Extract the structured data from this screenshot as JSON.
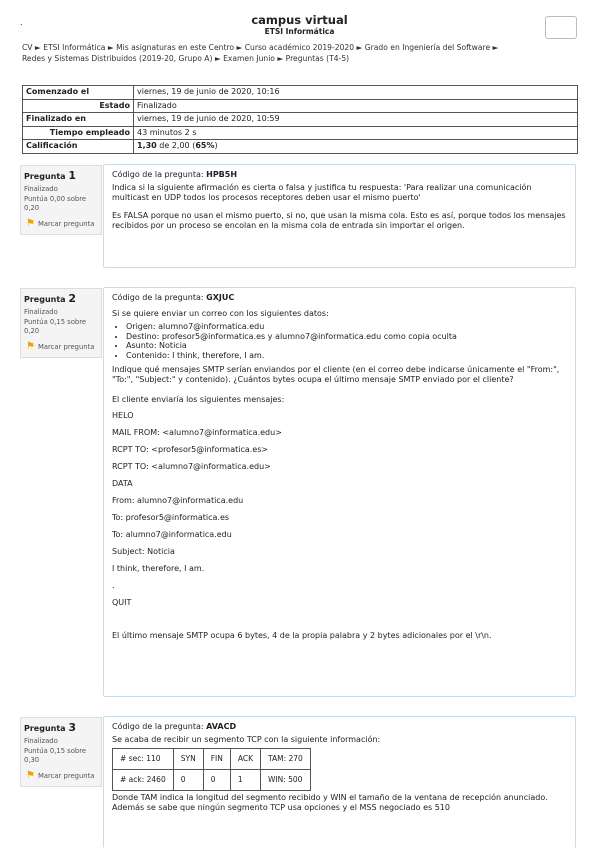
{
  "header": {
    "title": "campus virtual",
    "subtitle": "ETSI Informática",
    "dot": "."
  },
  "breadcrumb": [
    "CV ►",
    "ETSI Informática ►",
    "Mis asignaturas en este Centro ►",
    "Curso académico 2019-2020 ►",
    "Grado en Ingeniería del Software ►",
    "Redes y Sistemas Distribuidos (2019-20, Grupo A) ►",
    "Examen Junio ►",
    "Preguntas (T4-5)"
  ],
  "summary": {
    "started_label": "Comenzado el",
    "started_value": "viernes, 19 de junio de 2020, 10:16",
    "state_label": "Estado",
    "state_value": "Finalizado",
    "finished_label": "Finalizado en",
    "finished_value": "viernes, 19 de junio de 2020, 10:59",
    "time_label": "Tiempo empleado",
    "time_value": "43 minutos 2 s",
    "grade_label": "Calificación",
    "grade_score": "1,30",
    "grade_of": " de 2,00 (",
    "grade_percent": "65%",
    "grade_close": ")"
  },
  "questions": [
    {
      "label": "Pregunta",
      "number": "1",
      "state": "Finalizado",
      "score": "Puntúa 0,00 sobre 0,20",
      "flag": "Marcar pregunta",
      "code_prefix": "Código de la pregunta: ",
      "code": "HPB5H",
      "text": "Indica si la siguiente afirmación es cierta o falsa y justifica tu respuesta: 'Para realizar una comunicación multicast en UDP todos los procesos receptores deben usar el mismo puerto'",
      "answer": "Es FALSA porque no usan el mismo puerto, si no, que usan la misma cola. Esto es así, porque todos los mensajes recibidos por un proceso se encolan en la misma cola de entrada sin importar el origen."
    },
    {
      "label": "Pregunta",
      "number": "2",
      "state": "Finalizado",
      "score": "Puntúa 0,15 sobre 0,20",
      "flag": "Marcar pregunta",
      "code_prefix": "Código de la pregunta: ",
      "code": "GXJUC",
      "intro": "Si se quiere enviar un correo con los siguientes datos:",
      "bullets": [
        "Origen: alumno7@informatica.edu",
        "Destino: profesor5@informatica.es y alumno7@informatica.edu como copia oculta",
        "Asunto: Noticia",
        "Contenido: I think, therefore, I am."
      ],
      "question": "Indique qué mensajes SMTP serían enviandos por el cliente (en el correo debe indicarse únicamente el \"From:\", \"To:\", \"Subject:\" y contenido). ¿Cuántos bytes ocupa el último mensaje SMTP enviado por el cliente?",
      "answer_intro": "El cliente enviaría los siguientes mensajes:",
      "answer_lines": [
        "HELO",
        "MAIL FROM: <alumno7@informatica.edu>",
        "RCPT TO: <profesor5@informatica.es>",
        "RCPT TO: <alumno7@informatica.edu>",
        "DATA",
        "From: alumno7@informatica.edu",
        "To: profesor5@informatica.es",
        "To: alumno7@informatica.edu",
        "Subject: Noticia",
        "I think, therefore, I am.",
        ".",
        "QUIT"
      ],
      "answer_end": "El último mensaje SMTP ocupa 6 bytes, 4 de la propia palabra y 2 bytes adicionales por el \\r\\n."
    },
    {
      "label": "Pregunta",
      "number": "3",
      "state": "Finalizado",
      "score": "Puntúa 0,15 sobre 0,30",
      "flag": "Marcar pregunta",
      "code_prefix": "Código de la pregunta: ",
      "code": "AVACD",
      "intro": "Se acaba de recibir un segmento TCP con la siguiente información:",
      "table": [
        [
          "# sec: 110",
          "SYN",
          "FIN",
          "ACK",
          "TAM: 270"
        ],
        [
          "# ack: 2460",
          "0",
          "0",
          "1",
          "WIN: 500"
        ]
      ],
      "text": "Donde TAM indica la longitud del segmento recibido y WIN el tamaño de la ventana de recepción anunciado. Además se sabe que ningún segmento TCP usa opciones y el MSS negociado es 510"
    }
  ],
  "colors": {
    "question_border": "#c5dfe8",
    "info_bg": "#f4f4f4",
    "flag": "#e8a317"
  }
}
